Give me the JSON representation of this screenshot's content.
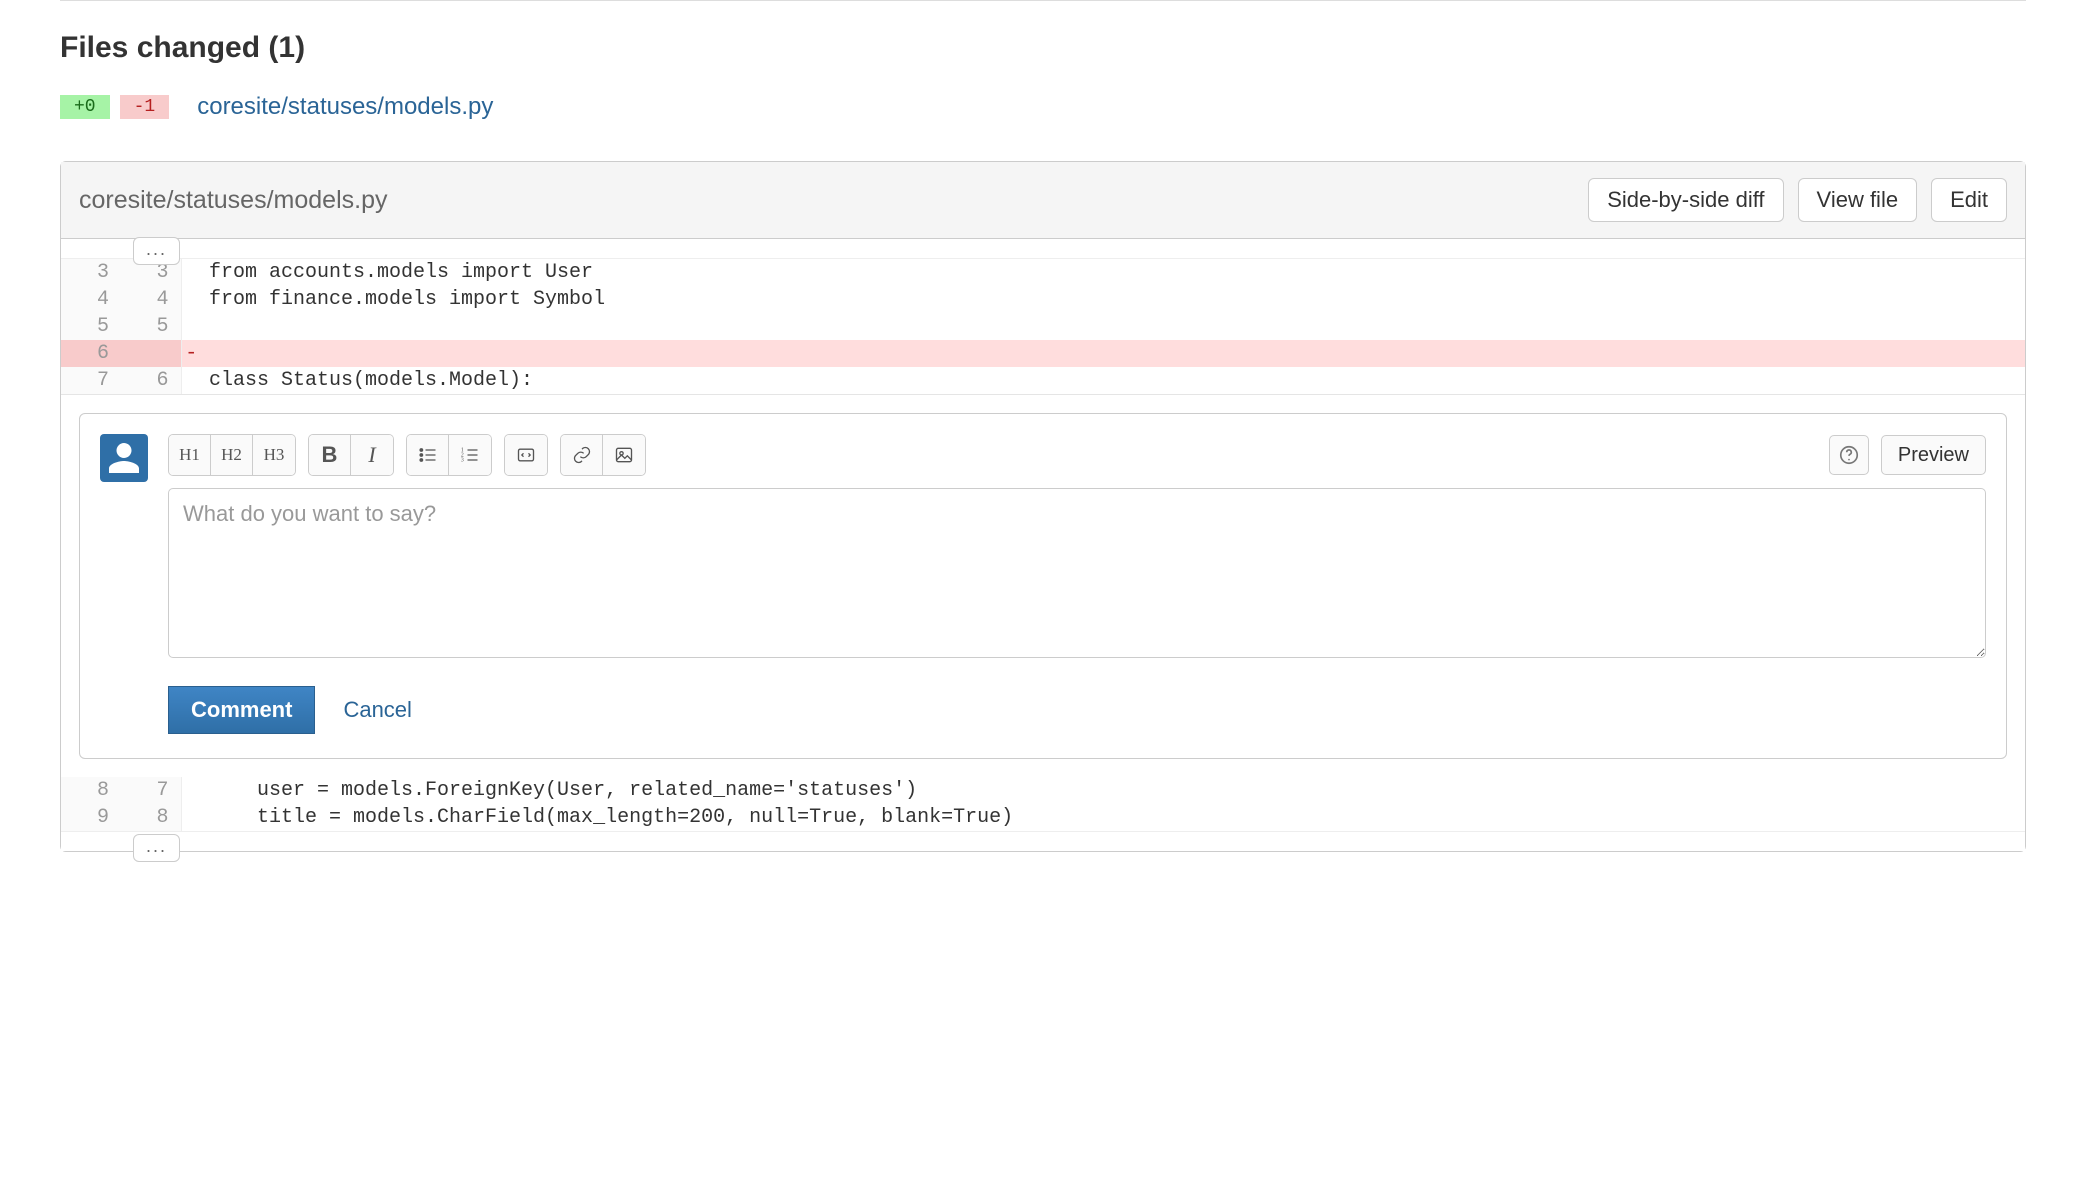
{
  "section_title": "Files changed (1)",
  "summary": {
    "additions": "+0",
    "deletions": "-1",
    "file_path": "coresite/statuses/models.py"
  },
  "file_header": {
    "path": "coresite/statuses/models.py",
    "side_by_side": "Side-by-side diff",
    "view_file": "View file",
    "edit": "Edit"
  },
  "expand_label": "...",
  "diff_lines": [
    {
      "old": "3",
      "new": "3",
      "type": "ctx",
      "text": "from accounts.models import User"
    },
    {
      "old": "4",
      "new": "4",
      "type": "ctx",
      "text": "from finance.models import Symbol"
    },
    {
      "old": "5",
      "new": "5",
      "type": "ctx",
      "text": ""
    },
    {
      "old": "6",
      "new": "",
      "type": "del",
      "text": ""
    },
    {
      "old": "7",
      "new": "6",
      "type": "ctx",
      "text": "class Status(models.Model):"
    }
  ],
  "diff_lines_after": [
    {
      "old": "8",
      "new": "7",
      "type": "ctx",
      "text": "    user = models.ForeignKey(User, related_name='statuses')"
    },
    {
      "old": "9",
      "new": "8",
      "type": "ctx",
      "text": "    title = models.CharField(max_length=200, null=True, blank=True)"
    }
  ],
  "toolbar": {
    "h1": "H1",
    "h2": "H2",
    "h3": "H3",
    "bold": "B",
    "italic": "I",
    "preview": "Preview"
  },
  "comment_box": {
    "placeholder": "What do you want to say?",
    "submit": "Comment",
    "cancel": "Cancel"
  }
}
